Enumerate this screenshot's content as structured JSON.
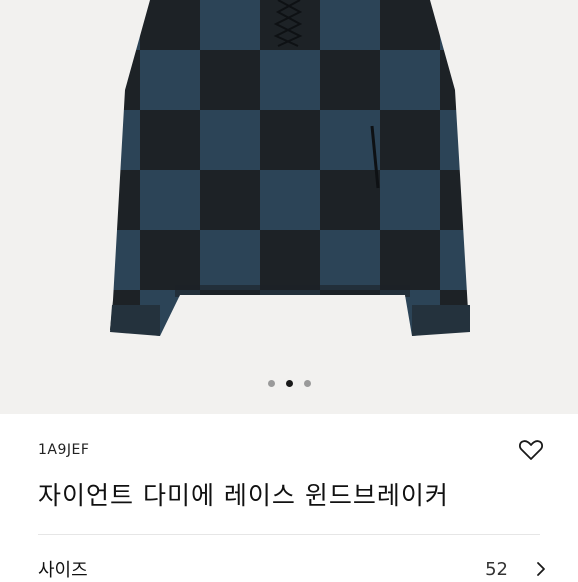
{
  "carousel": {
    "image_alt": "checkered dark blue windbreaker",
    "slide_count": 3,
    "active_index": 1
  },
  "product": {
    "sku": "1A9JEF",
    "name": "자이언트 다미에 레이스 윈드브레이커",
    "wishlist_icon": "heart-outline-icon"
  },
  "size_selector": {
    "label": "사이즈",
    "value": "52",
    "chevron_icon": "chevron-right-icon"
  },
  "colors": {
    "background_hero": "#f2f1ef",
    "jacket_dark": "#1d2226",
    "jacket_blue": "#2c4457"
  }
}
